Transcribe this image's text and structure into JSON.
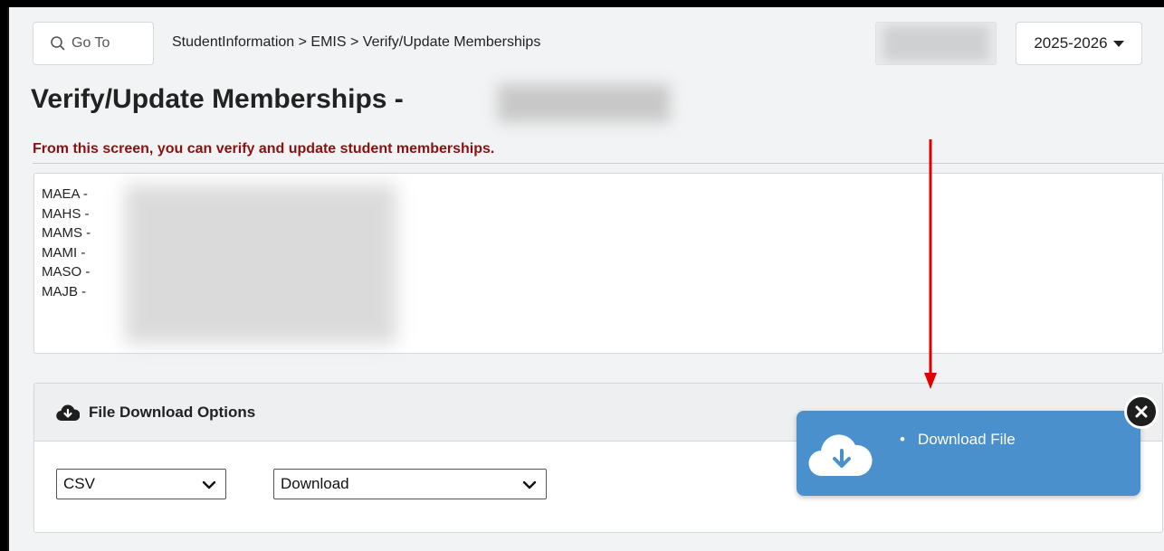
{
  "header": {
    "goto_label": "Go To",
    "breadcrumb": "StudentInformation > EMIS > Verify/Update Memberships",
    "year": "2025-2026"
  },
  "page": {
    "title": "Verify/Update Memberships -",
    "subtitle": "From this screen, you can verify and update student memberships."
  },
  "schools": [
    "MAEA -",
    "MAHS -",
    "MAMS -",
    "MAMI -",
    "MASO -",
    "MAJB -"
  ],
  "download_panel": {
    "title": "File Download Options",
    "format_value": "CSV",
    "action_value": "Download"
  },
  "toast": {
    "message": "Download File"
  },
  "colors": {
    "subtitle": "#8b1111",
    "toast_bg": "#4a90cd",
    "arrow": "#e00000"
  },
  "icons": {
    "goto": "search-icon",
    "year": "caret-down-icon",
    "panel": "cloud-download-icon",
    "toast": "cloud-download-icon",
    "close": "close-icon"
  }
}
